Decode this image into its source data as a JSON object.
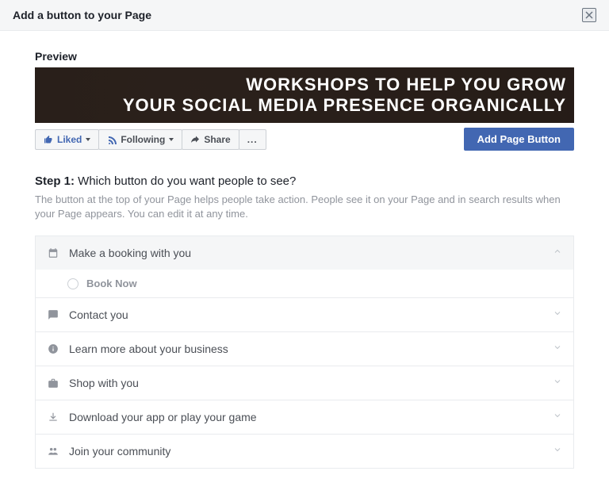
{
  "header": {
    "title": "Add a button to your Page"
  },
  "preview": {
    "label": "Preview",
    "banner_line1": "WORKSHOPS TO HELP YOU GROW",
    "banner_line2": "YOUR SOCIAL MEDIA PRESENCE ORGANICALLY",
    "liked": "Liked",
    "following": "Following",
    "share": "Share",
    "more": "...",
    "add_button": "Add Page Button"
  },
  "step": {
    "prefix": "Step 1:",
    "question": " Which button do you want people to see?",
    "desc": "The button at the top of your Page helps people take action. People see it on your Page and in search results when your Page appears. You can edit it at any time."
  },
  "groups": [
    {
      "label": "Make a book­ing with you",
      "open": true,
      "icon": "calendar",
      "options": [
        {
          "label": "Book Now"
        }
      ]
    },
    {
      "label": "Contact you",
      "open": false,
      "icon": "chat"
    },
    {
      "label": "Learn more about your business",
      "open": false,
      "icon": "info"
    },
    {
      "label": "Shop with you",
      "open": false,
      "icon": "bag"
    },
    {
      "label": "Download your app or play your game",
      "open": false,
      "icon": "download"
    },
    {
      "label": "Join your community",
      "open": false,
      "icon": "group"
    }
  ]
}
